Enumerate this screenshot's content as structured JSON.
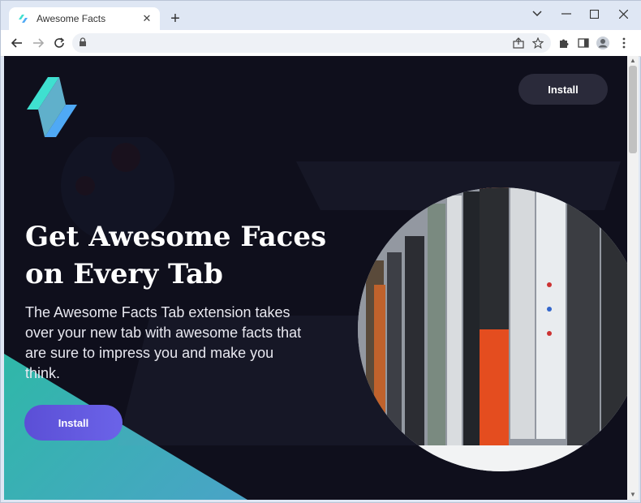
{
  "browser": {
    "tab_title": "Awesome Facts",
    "tab_close": "✕",
    "new_tab": "+",
    "url": ""
  },
  "page": {
    "install_top_label": "Install",
    "headline_line1": "Get Awesome Faces",
    "headline_line2": "on Every Tab",
    "description": "The Awesome Facts Tab extension takes over your new tab with awesome facts that are sure to impress you and make you think.",
    "install_main_label": "Install"
  },
  "colors": {
    "background": "#0f0f1c",
    "accent_button": "#5b4fd6",
    "teal_shape": "#2fb8a8",
    "logo_cyan": "#3fe0d0",
    "logo_blue": "#4fa9f5"
  }
}
